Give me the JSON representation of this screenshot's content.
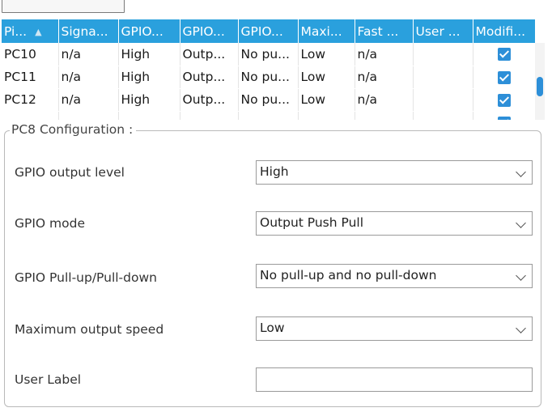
{
  "table": {
    "columns": [
      "Pi...",
      "Signa...",
      "GPIO...",
      "GPIO...",
      "GPIO...",
      "Maxi...",
      "Fast ...",
      "User ...",
      "Modifi..."
    ],
    "rows": [
      {
        "pin": "PC10",
        "signal": "n/a",
        "output_level": "High",
        "mode": "Outp...",
        "pull": "No pu...",
        "speed": "Low",
        "fast": "n/a",
        "user_label": "",
        "modified": true
      },
      {
        "pin": "PC11",
        "signal": "n/a",
        "output_level": "High",
        "mode": "Outp...",
        "pull": "No pu...",
        "speed": "Low",
        "fast": "n/a",
        "user_label": "",
        "modified": true
      },
      {
        "pin": "PC12",
        "signal": "n/a",
        "output_level": "High",
        "mode": "Outp...",
        "pull": "No pu...",
        "speed": "Low",
        "fast": "n/a",
        "user_label": "",
        "modified": true
      }
    ]
  },
  "config": {
    "title": "PC8 Configuration :",
    "fields": [
      {
        "label": "GPIO output level",
        "value": "High"
      },
      {
        "label": "GPIO mode",
        "value": "Output Push Pull"
      },
      {
        "label": "GPIO Pull-up/Pull-down",
        "value": "No pull-up and no pull-down"
      },
      {
        "label": "Maximum output speed",
        "value": "Low"
      },
      {
        "label": "User Label",
        "value": ""
      }
    ]
  },
  "colors": {
    "header_bg": "#2aa0dd",
    "accent": "#2d8fd8"
  }
}
